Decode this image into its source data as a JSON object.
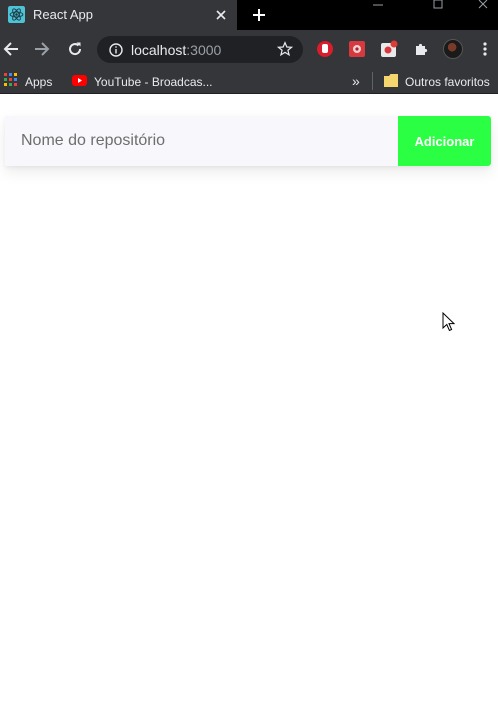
{
  "tab": {
    "title": "React App",
    "favicon": "react-logo-icon"
  },
  "toolbar": {
    "url_host": "localhost",
    "url_port": ":3000"
  },
  "bookmarks": {
    "apps_label": "Apps",
    "youtube_label": "YouTube - Broadcas...",
    "more_label": "»",
    "other_label": "Outros favoritos"
  },
  "form": {
    "input_placeholder": "Nome do repositório",
    "input_value": "",
    "button_label": "Adicionar"
  },
  "colors": {
    "accent_button": "#2bff44",
    "input_background": "#f8f7fb",
    "chrome_dark": "#35363a"
  }
}
